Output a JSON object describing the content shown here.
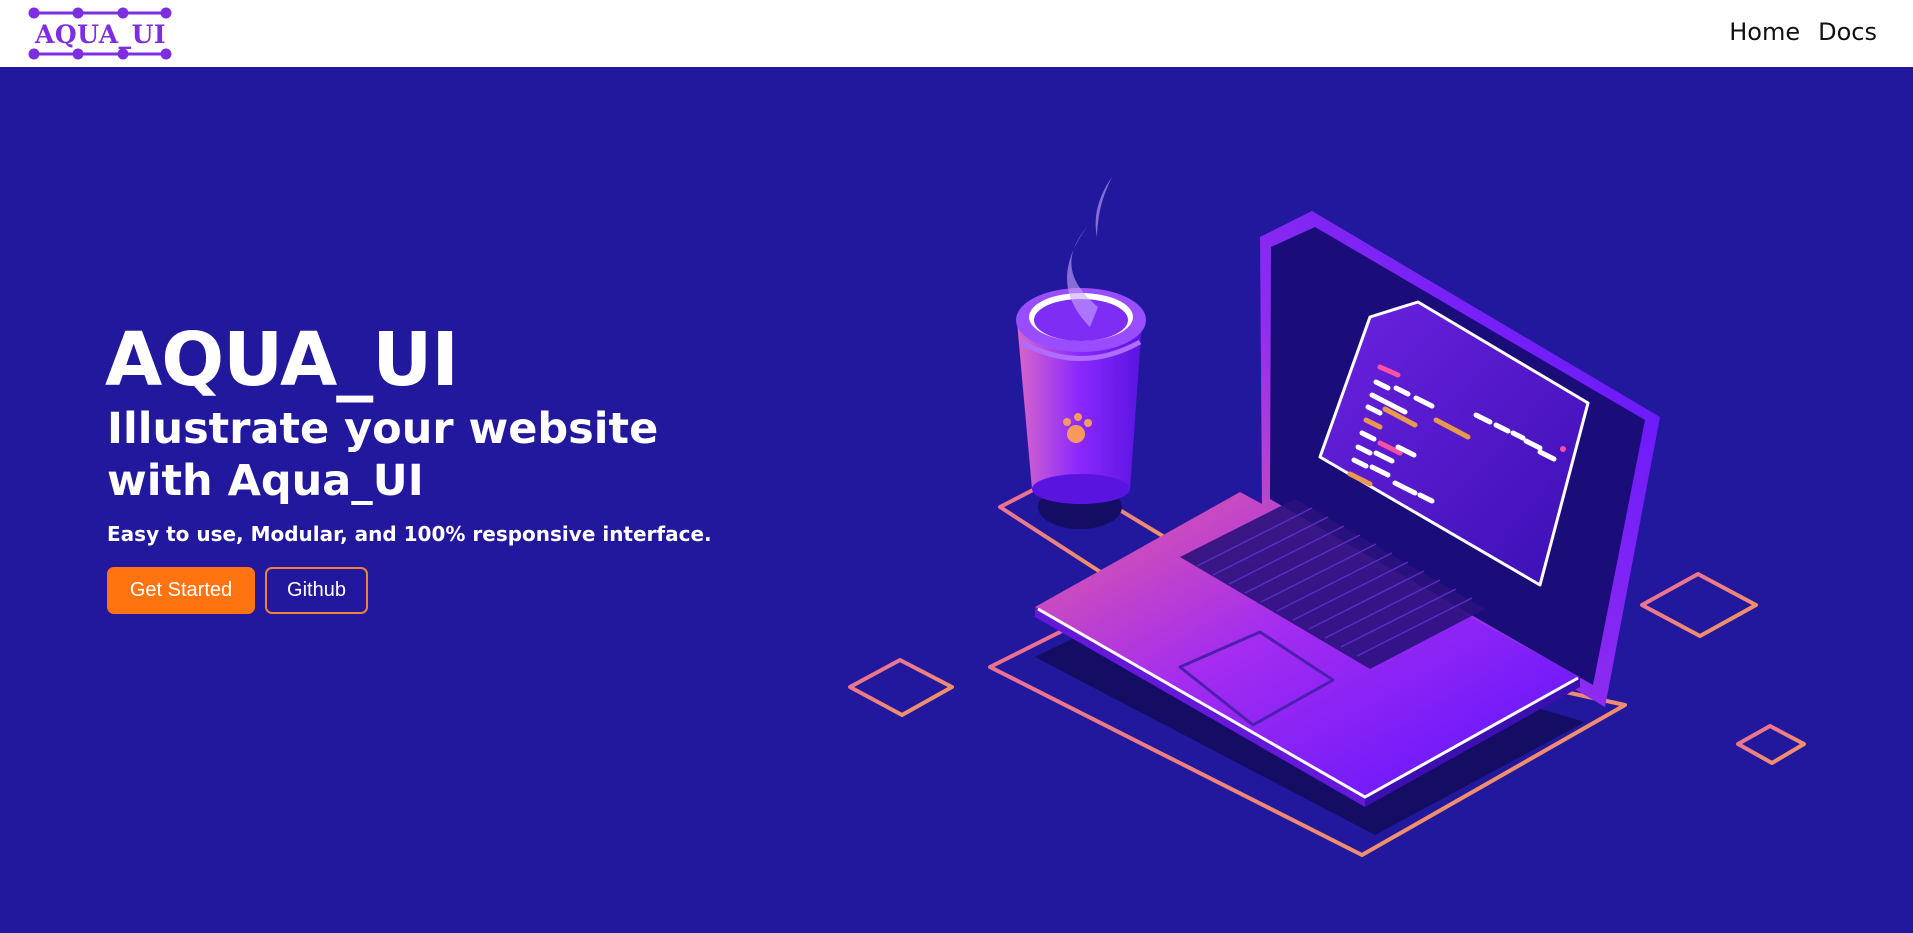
{
  "navbar": {
    "logo_text": "AQUA_UI",
    "links": [
      {
        "label": "Home"
      },
      {
        "label": "Docs"
      }
    ]
  },
  "hero": {
    "title": "AQUA_UI",
    "subtitle": "Illustrate your website with Aqua_UI",
    "description": "Easy to use, Modular, and 100% responsive interface.",
    "primary_button": "Get Started",
    "secondary_button": "Github"
  },
  "colors": {
    "hero_background": "#21189e",
    "accent_orange": "#ff7410",
    "logo_purple": "#7d2ee0",
    "navbar_background": "#ffffff"
  },
  "illustration": {
    "icon": "laptop-coffee-illustration"
  }
}
